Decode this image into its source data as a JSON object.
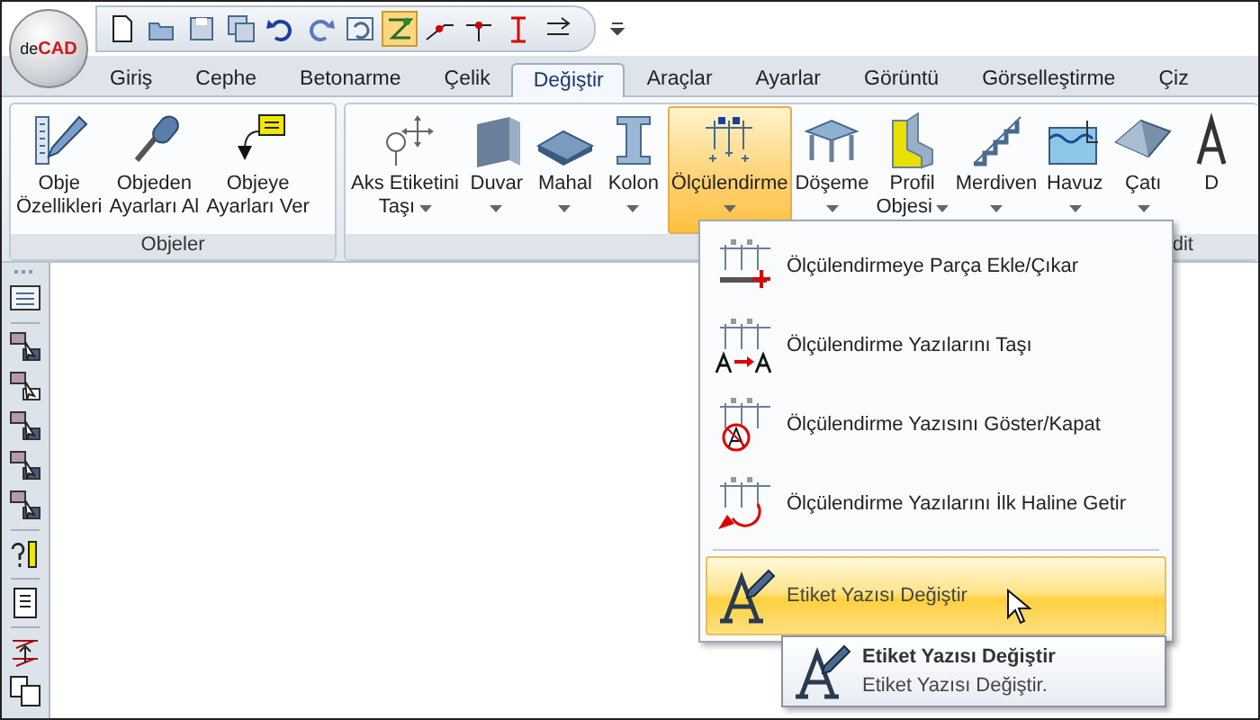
{
  "logo": {
    "prefix": "de",
    "name": "CAD"
  },
  "quick_access": [
    {
      "kind": "new",
      "selected": false
    },
    {
      "kind": "open",
      "selected": false
    },
    {
      "kind": "save",
      "selected": false
    },
    {
      "kind": "saveall",
      "selected": false
    },
    {
      "kind": "undo",
      "selected": false
    },
    {
      "kind": "redo",
      "selected": false
    },
    {
      "kind": "undoall",
      "selected": false
    },
    {
      "kind": "snap",
      "selected": true
    },
    {
      "kind": "point",
      "selected": false
    },
    {
      "kind": "mid",
      "selected": false
    },
    {
      "kind": "perp",
      "selected": false
    },
    {
      "kind": "parallel",
      "selected": false
    }
  ],
  "tabs": [
    {
      "label": "Giriş",
      "selected": false
    },
    {
      "label": "Cephe",
      "selected": false
    },
    {
      "label": "Betonarme",
      "selected": false
    },
    {
      "label": "Çelik",
      "selected": false
    },
    {
      "label": "Değiştir",
      "selected": true
    },
    {
      "label": "Araçlar",
      "selected": false
    },
    {
      "label": "Ayarlar",
      "selected": false
    },
    {
      "label": "Görüntü",
      "selected": false
    },
    {
      "label": "Görselleştirme",
      "selected": false
    },
    {
      "label": "Çiz",
      "selected": false
    }
  ],
  "ribbon": {
    "groups": [
      {
        "label": "Objeler",
        "buttons": [
          {
            "lines": [
              "Obje",
              "Özellikleri"
            ],
            "dropdown": false,
            "selected": false
          },
          {
            "lines": [
              "Objeden",
              "Ayarları Al"
            ],
            "dropdown": false,
            "selected": false
          },
          {
            "lines": [
              "Objeye",
              "Ayarları Ver"
            ],
            "dropdown": false,
            "selected": false
          }
        ]
      },
      {
        "label": "dit",
        "buttons": [
          {
            "lines": [
              "Aks Etiketini",
              "Taşı"
            ],
            "dropdown": true,
            "selected": false
          },
          {
            "lines": [
              "Duvar"
            ],
            "dropdown": true,
            "selected": false
          },
          {
            "lines": [
              "Mahal"
            ],
            "dropdown": true,
            "selected": false
          },
          {
            "lines": [
              "Kolon"
            ],
            "dropdown": true,
            "selected": false
          },
          {
            "lines": [
              "Ölçülendirme"
            ],
            "dropdown": true,
            "selected": true
          },
          {
            "lines": [
              "Döşeme"
            ],
            "dropdown": true,
            "selected": false
          },
          {
            "lines": [
              "Profil",
              "Objesi"
            ],
            "dropdown": true,
            "selected": false
          },
          {
            "lines": [
              "Merdiven"
            ],
            "dropdown": true,
            "selected": false
          },
          {
            "lines": [
              "Havuz"
            ],
            "dropdown": true,
            "selected": false
          },
          {
            "lines": [
              "Çatı"
            ],
            "dropdown": true,
            "selected": false
          },
          {
            "lines": [
              "D"
            ],
            "dropdown": false,
            "selected": false
          }
        ]
      }
    ]
  },
  "menu": {
    "items": [
      {
        "label": "Ölçülendirmeye Parça Ekle/Çıkar",
        "selected": false
      },
      {
        "label": "Ölçülendirme Yazılarını Taşı",
        "selected": false
      },
      {
        "label": "Ölçülendirme Yazısını Göster/Kapat",
        "selected": false
      },
      {
        "label": "Ölçülendirme Yazılarını İlk Haline Getir",
        "selected": false
      },
      {
        "label": "Etiket Yazısı Değiştir",
        "selected": true
      }
    ]
  },
  "tooltip": {
    "title": "Etiket Yazısı Değiştir",
    "description": "Etiket Yazısı Değiştir."
  }
}
